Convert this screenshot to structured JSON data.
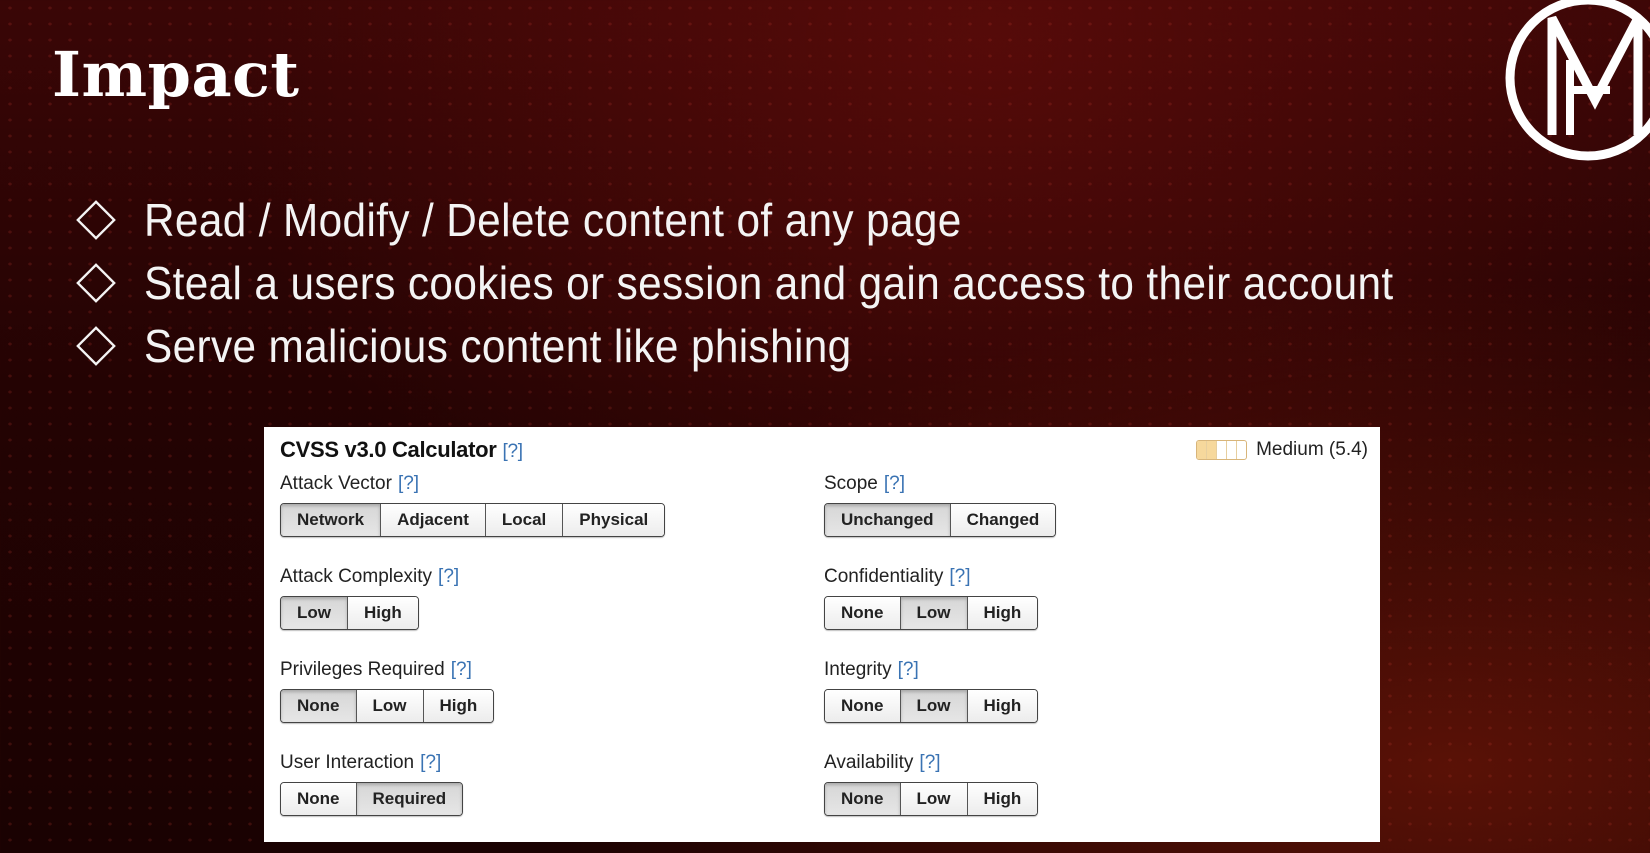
{
  "slide": {
    "title": "Impact",
    "bullets": [
      "Read / Modify / Delete content of any page",
      "Steal a users cookies or session and gain access to their account",
      "Serve malicious content like phishing"
    ]
  },
  "calculator": {
    "title": "CVSS v3.0 Calculator",
    "help": "[?]",
    "score_label": "Medium (5.4)",
    "meter_level": 0.4,
    "metrics": {
      "attack_vector": {
        "label": "Attack Vector",
        "options": [
          "Network",
          "Adjacent",
          "Local",
          "Physical"
        ],
        "selected": "Network"
      },
      "attack_complexity": {
        "label": "Attack Complexity",
        "options": [
          "Low",
          "High"
        ],
        "selected": "Low"
      },
      "privileges_required": {
        "label": "Privileges Required",
        "options": [
          "None",
          "Low",
          "High"
        ],
        "selected": "None"
      },
      "user_interaction": {
        "label": "User Interaction",
        "options": [
          "None",
          "Required"
        ],
        "selected": "Required"
      },
      "scope": {
        "label": "Scope",
        "options": [
          "Unchanged",
          "Changed"
        ],
        "selected": "Unchanged"
      },
      "confidentiality": {
        "label": "Confidentiality",
        "options": [
          "None",
          "Low",
          "High"
        ],
        "selected": "Low"
      },
      "integrity": {
        "label": "Integrity",
        "options": [
          "None",
          "Low",
          "High"
        ],
        "selected": "Low"
      },
      "availability": {
        "label": "Availability",
        "options": [
          "None",
          "Low",
          "High"
        ],
        "selected": "None"
      }
    }
  },
  "colors": {
    "help_link": "#3a73b3",
    "meter_fill": "#f6d89c"
  }
}
